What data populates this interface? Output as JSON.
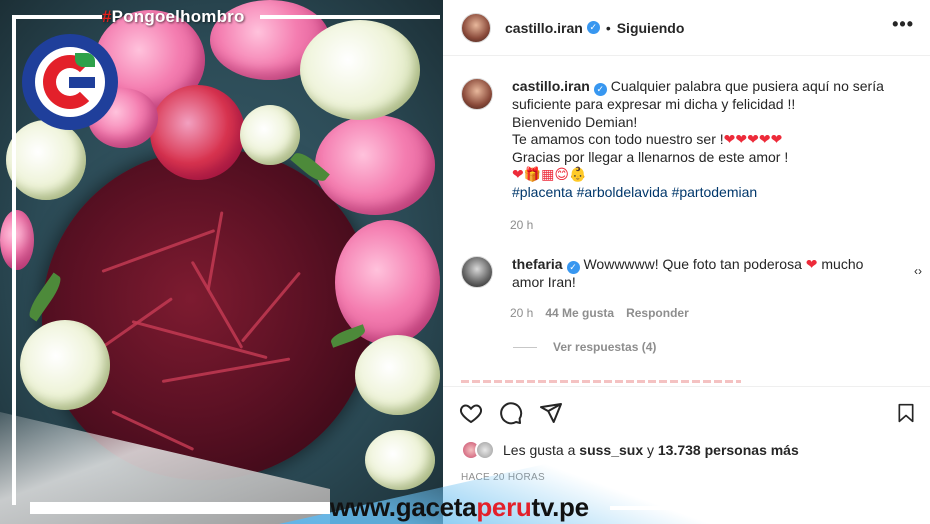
{
  "overlay": {
    "hashtag": "#Pongoelhombro",
    "site_prefix": "www.",
    "site_main": "gaceta",
    "site_accent": "peru",
    "site_suffix": "tv.pe",
    "brand_colors": {
      "red": "#e3202a",
      "blue": "#1f3f9b",
      "green": "#2ea14a",
      "band_blue": "#3fa6ea"
    }
  },
  "post": {
    "author": "castillo.iran",
    "follow_status": "Siguiendo",
    "more_icon": "more-horizontal-icon",
    "caption_lines": [
      "Cualquier palabra que pusiera aquí no sería",
      "suficiente para expresar mi dicha y felicidad !!",
      "Bienvenido Demian!",
      "Te amamos con todo nuestro ser !",
      "Gracias por llegar a llenarnos de este amor !"
    ],
    "caption_hearts": "❤❤❤❤❤",
    "caption_emojis": "❤🎁▦😊👶",
    "hashtags": [
      "#placenta",
      "#arboldelavida",
      "#partodemian"
    ],
    "time": "20 h"
  },
  "comment": {
    "author": "thefaria",
    "text_before_heart": "Wowwwww! Que foto tan poderosa",
    "heart": "❤",
    "text_after_heart": "mucho",
    "text_line2": "amor Iran!",
    "time": "20 h",
    "likes": "44 Me gusta",
    "reply": "Responder",
    "view_replies": "Ver respuestas (4)",
    "side_icon": "‹›"
  },
  "actions": {
    "icons": [
      "heart-icon",
      "comment-icon",
      "share-icon",
      "bookmark-icon"
    ]
  },
  "likes": {
    "prefix": "Les gusta a",
    "user": "suss_sux",
    "connector": "y",
    "count": "13.738 personas más"
  },
  "posted_ago": "HACE 20 HORAS"
}
